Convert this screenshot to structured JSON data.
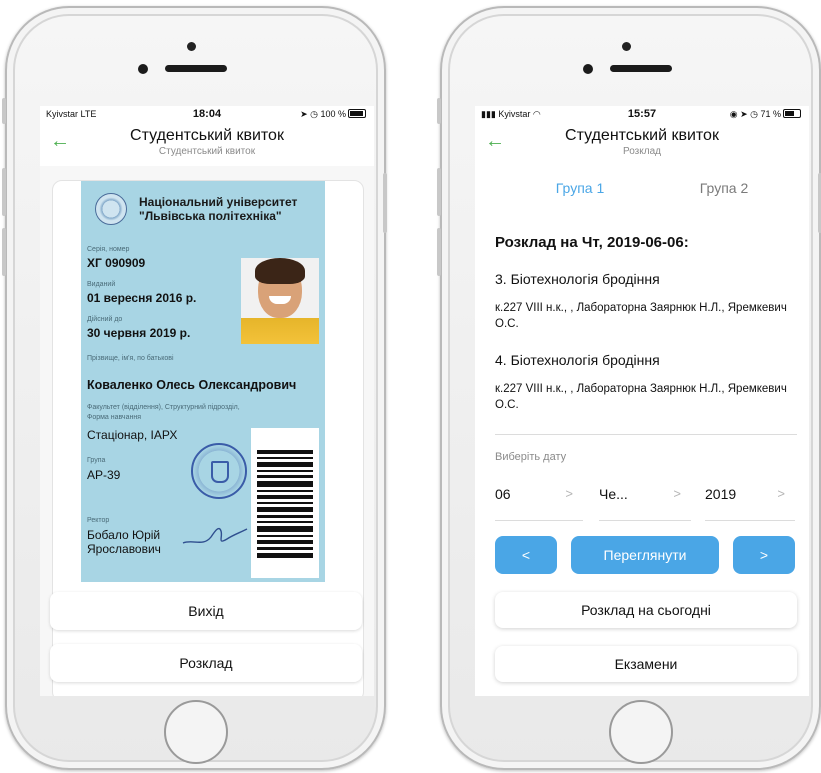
{
  "left": {
    "status": {
      "carrier": "Kyivstar  LTE",
      "time": "18:04",
      "right": "100 %"
    },
    "nav": {
      "back_icon": "arrow-left-icon",
      "title": "Студентський квиток",
      "subtitle": "Студентський квиток"
    },
    "card": {
      "university": "Національний університет \"Львівська політехніка\"",
      "series_label": "Серія, номер",
      "series_value": "ХГ 090909",
      "issued_label": "Виданий",
      "issued_value": "01 вересня 2016 р.",
      "valid_label": "Дійсний до",
      "valid_value": "30 червня 2019 р.",
      "name_label": "Прізвище, ім'я, по батькові",
      "name_value": "Коваленко Олесь Олександрович",
      "faculty_label": "Факультет (відділення), Структурний підрозділ, Форма навчання",
      "faculty_value": "Стаціонар, ІАРХ",
      "group_label": "Група",
      "group_value": "АР-39",
      "rector_label": "Ректор",
      "rector_value": "Бобало Юрій Ярославович"
    },
    "buttons": {
      "exit": "Вихід",
      "schedule": "Розклад"
    }
  },
  "right": {
    "status": {
      "carrier": "Kyivstar",
      "time": "15:57",
      "right": "71 %"
    },
    "nav": {
      "back_icon": "arrow-left-icon",
      "title": "Студентський квиток",
      "subtitle": "Розклад"
    },
    "tabs": [
      {
        "label": "Група 1",
        "active": true
      },
      {
        "label": "Група 2",
        "active": false
      }
    ],
    "heading": "Розклад на Чт, 2019-06-06:",
    "lessons": [
      {
        "title": "3. Біотехнологія бродіння",
        "details": "к.227 VIII н.к., , Лабораторна Заярнюк Н.Л., Яремкевич О.С."
      },
      {
        "title": "4. Біотехнологія бродіння",
        "details": "к.227 VIII н.к., , Лабораторна Заярнюк Н.Л., Яремкевич О.С."
      }
    ],
    "date_picker": {
      "label": "Виберіть дату",
      "day": "06",
      "month": "Че...",
      "year": "2019"
    },
    "buttons": {
      "prev": "<",
      "view": "Переглянути",
      "next": ">",
      "today": "Розклад на сьогодні",
      "exams": "Екзамени"
    }
  },
  "colors": {
    "accent_blue": "#4aa6e6",
    "back_green": "#4caf50",
    "card_blue": "#a8d5e4"
  }
}
